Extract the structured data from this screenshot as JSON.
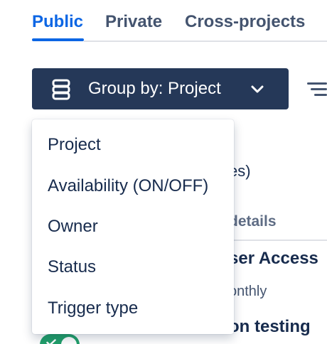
{
  "tabs": [
    {
      "label": "Public",
      "active": true
    },
    {
      "label": "Private",
      "active": false
    },
    {
      "label": "Cross-projects",
      "active": false
    }
  ],
  "group_by": {
    "label": "Group by: Project",
    "icon": "stack-icon",
    "chevron": "chevron-down-icon"
  },
  "filter": {
    "icon": "filter-icon"
  },
  "menu": {
    "items": [
      "Project",
      "Availability (ON/OFF)",
      "Owner",
      "Status",
      "Trigger type"
    ]
  },
  "background": {
    "count_fragment": "es)",
    "column_header_fragment": "details",
    "row1_title_fragment": "ser Access",
    "row1_subtitle_fragment": "onthly",
    "row2_title_fragment": "on testing",
    "toggle_on": true
  },
  "colors": {
    "accent": "#0c66e4",
    "button_bg": "#253858",
    "toggle_on": "#22a06b"
  }
}
